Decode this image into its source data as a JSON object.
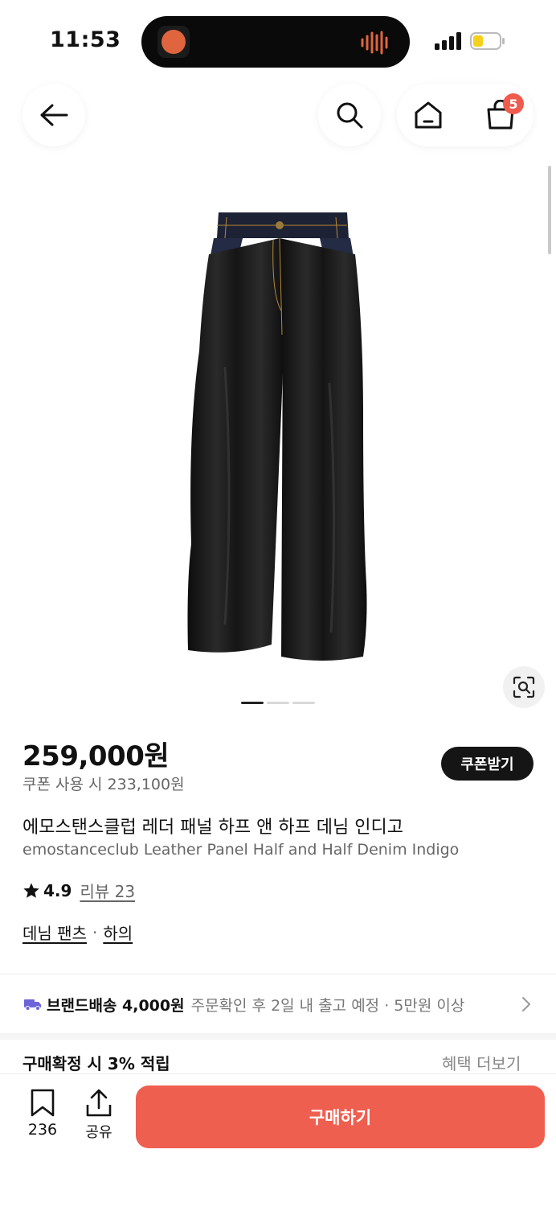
{
  "status_bar": {
    "time": "11:53"
  },
  "nav": {
    "cart_count": "5"
  },
  "product": {
    "price": "259,000원",
    "coupon_price": "쿠폰 사용 시 233,100원",
    "coupon_button": "쿠폰받기",
    "title_ko": "에모스탠스클럽 레더 패널 하프 앤 하프 데님 인디고",
    "title_en": "emostanceclub Leather Panel Half and Half Denim Indigo",
    "rating": "4.9",
    "review_label": "리뷰 23",
    "category_1": "데님 팬츠",
    "category_sep": "·",
    "category_2": "하의",
    "image_page": {
      "current": 1,
      "total": 3
    }
  },
  "shipping": {
    "label": "브랜드배송 4,000원",
    "info": "주문확인 후 2일 내 출고 예정 · 5만원 이상"
  },
  "reward": {
    "label": "구매확정 시 3% 적립",
    "more": "혜택 더보기"
  },
  "bottom_bar": {
    "bookmark_count": "236",
    "share_label": "공유",
    "buy_label": "구매하기"
  },
  "colors": {
    "accent": "#ef5f50",
    "badge": "#ef5b4c",
    "dark_button": "#151515",
    "shipping_icon": "#6c63d9"
  },
  "icons": [
    "back-arrow-icon",
    "search-icon",
    "home-icon",
    "shopping-bag-icon",
    "lens-icon",
    "star-icon",
    "truck-icon",
    "chevron-right-icon",
    "bookmark-icon",
    "share-icon"
  ]
}
